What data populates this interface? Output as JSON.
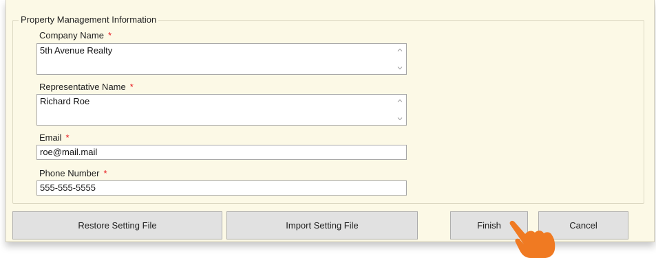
{
  "group": {
    "title": "Property Management Information"
  },
  "fields": {
    "company": {
      "label": "Company Name",
      "value": "5th Avenue Realty"
    },
    "representative": {
      "label": "Representative Name",
      "value": "Richard Roe"
    },
    "email": {
      "label": "Email",
      "value": "roe@mail.mail"
    },
    "phone": {
      "label": "Phone Number",
      "value": "555-555-5555"
    },
    "required_marker": "*"
  },
  "buttons": {
    "restore": "Restore Setting File",
    "import": "Import Setting File",
    "finish": "Finish",
    "cancel": "Cancel"
  },
  "icons": {
    "pointer": "pointing-hand-icon"
  },
  "colors": {
    "panel_background": "#fcf9e6",
    "required": "#e8151b",
    "button_face": "#e1e1e1",
    "pointer_hand": "#f07a22"
  }
}
